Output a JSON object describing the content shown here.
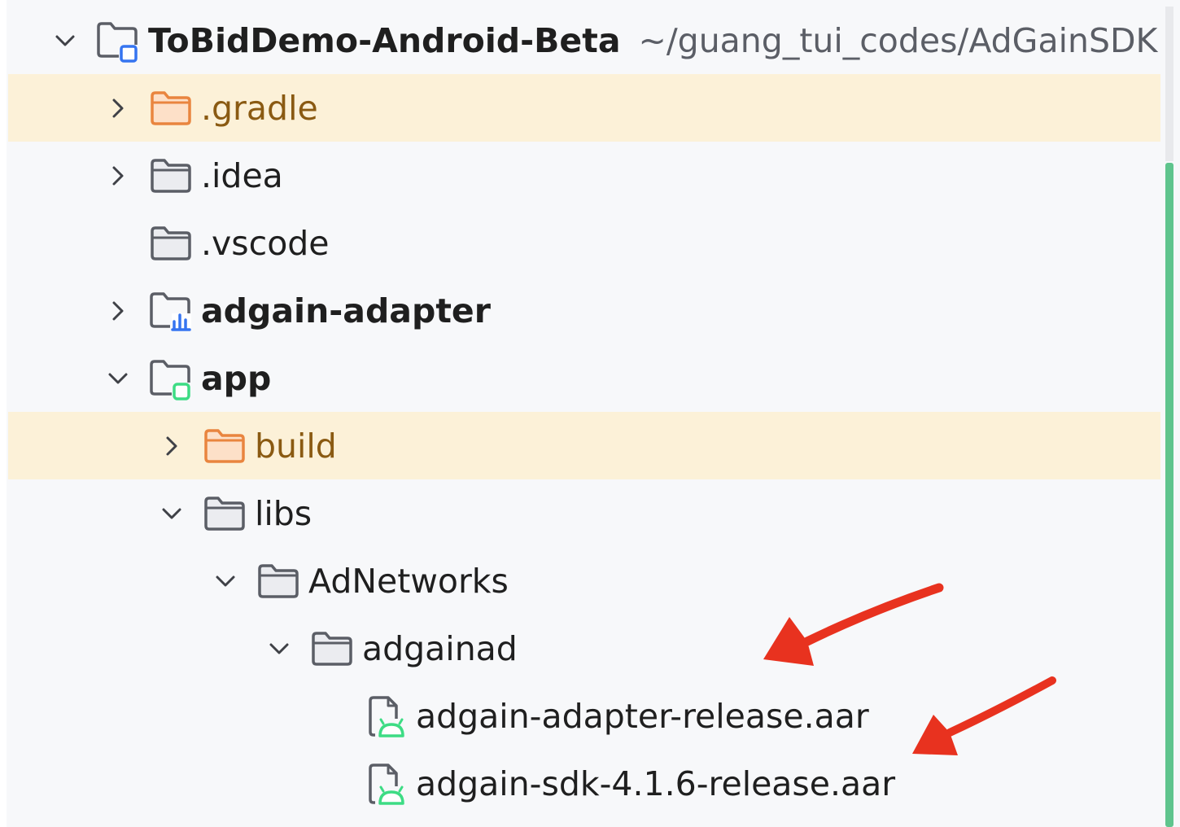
{
  "tree": {
    "rows": [
      {
        "label": "ToBidDemo-Android-Beta",
        "path": "~/guang_tui_codes/AdGainSDK",
        "icon": "project-module-icon",
        "chevron": "expanded"
      },
      {
        "label": ".gradle",
        "icon": "folder-excluded-icon",
        "chevron": "collapsed"
      },
      {
        "label": ".idea",
        "icon": "folder-icon",
        "chevron": "collapsed"
      },
      {
        "label": ".vscode",
        "icon": "folder-icon",
        "chevron": "none"
      },
      {
        "label": "adgain-adapter",
        "icon": "library-module-icon",
        "chevron": "collapsed"
      },
      {
        "label": "app",
        "icon": "android-app-module-icon",
        "chevron": "expanded"
      },
      {
        "label": "build",
        "icon": "folder-excluded-icon",
        "chevron": "collapsed"
      },
      {
        "label": "libs",
        "icon": "folder-icon",
        "chevron": "expanded"
      },
      {
        "label": "AdNetworks",
        "icon": "folder-icon",
        "chevron": "expanded"
      },
      {
        "label": "adgainad",
        "icon": "folder-icon",
        "chevron": "expanded"
      },
      {
        "label": "adgain-adapter-release.aar",
        "icon": "aar-file-icon",
        "chevron": "none"
      },
      {
        "label": "adgain-sdk-4.1.6-release.aar",
        "icon": "aar-file-icon",
        "chevron": "none"
      }
    ]
  },
  "colors": {
    "excluded_row": "#fcf1d8",
    "excluded_folder": "#e9853f",
    "module_blue": "#3574f0",
    "android_green": "#3ddc84",
    "annotation_arrow": "#e8321f"
  }
}
